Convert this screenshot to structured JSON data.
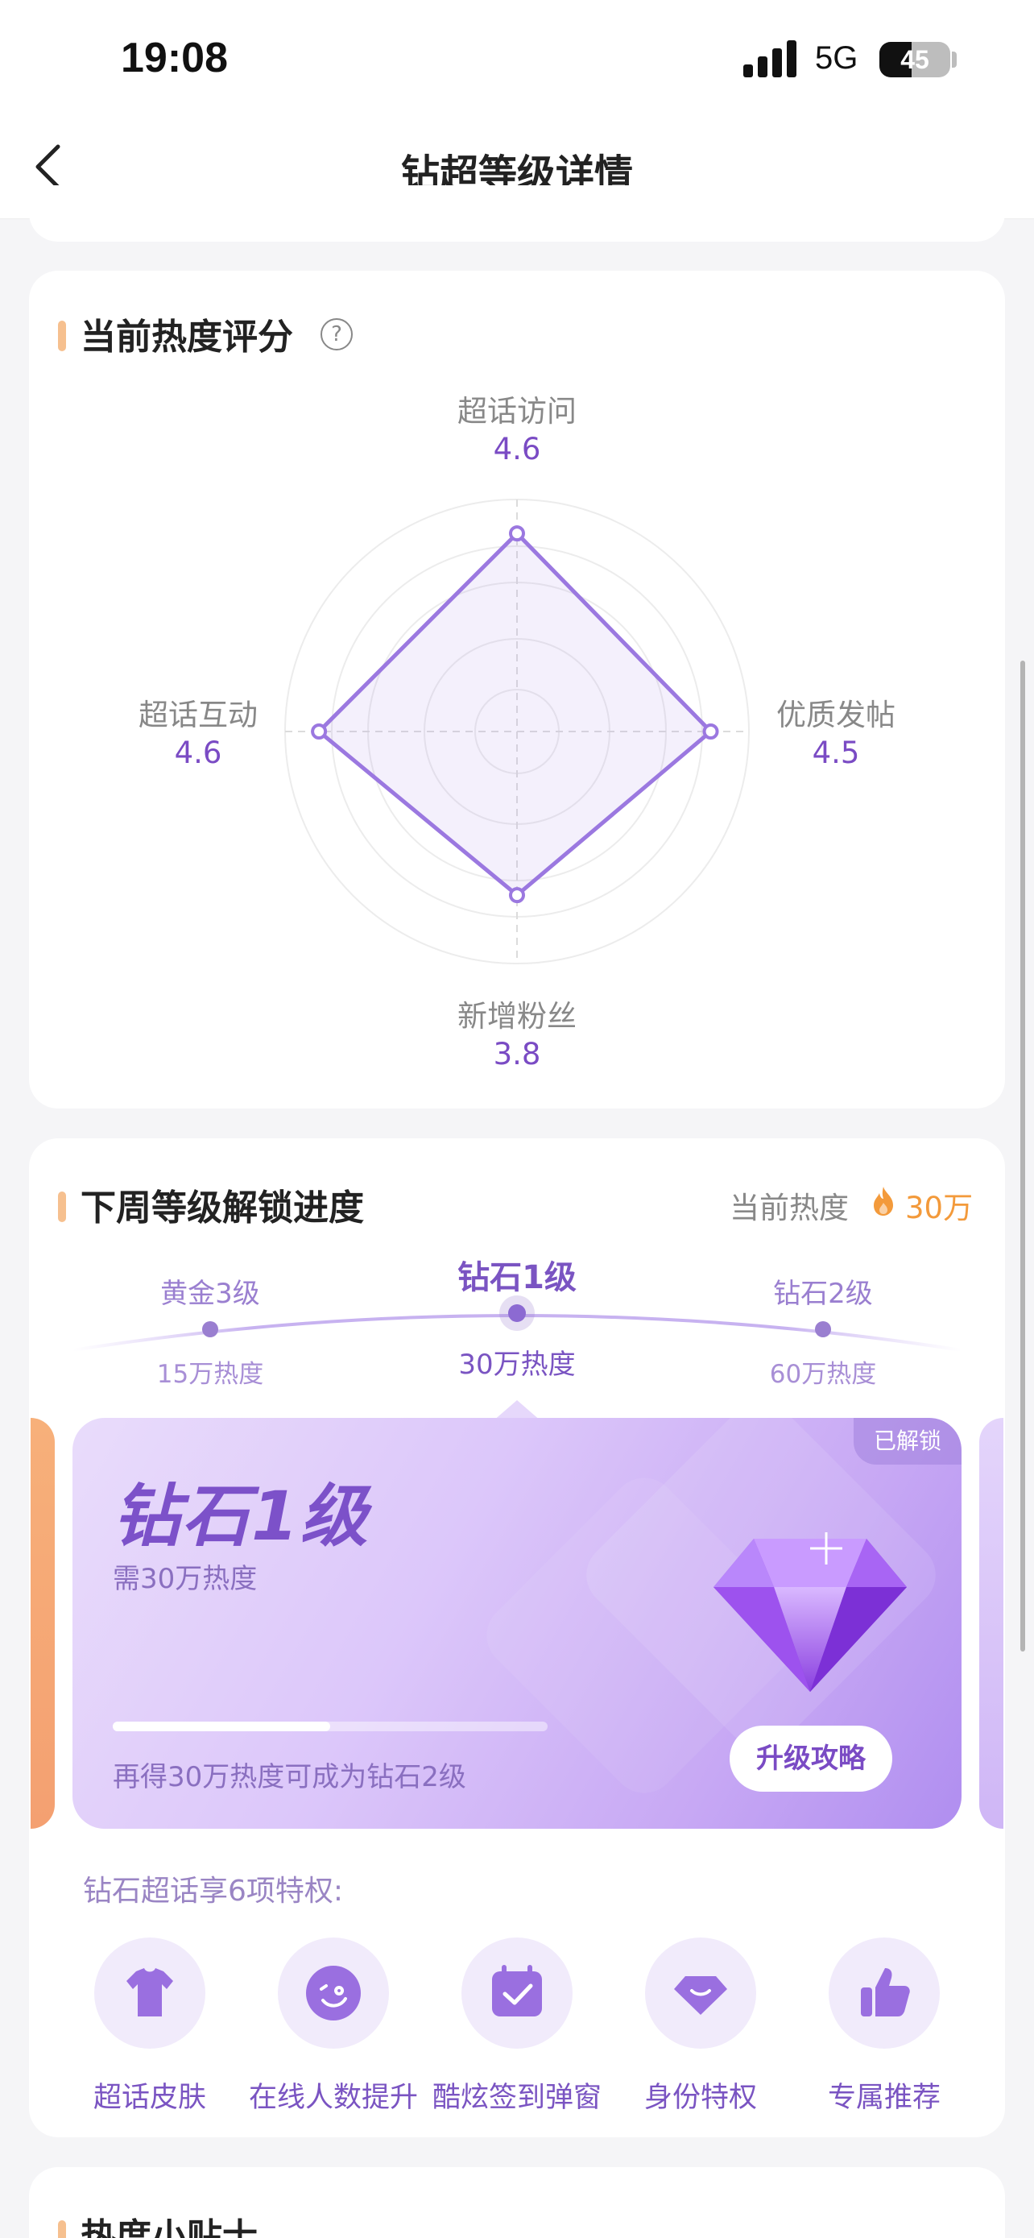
{
  "status_bar": {
    "time": "19:08",
    "network": "5G",
    "battery": "45",
    "battery_level": 0.45
  },
  "nav": {
    "title": "钻超等级详情"
  },
  "heat_score": {
    "title": "当前热度评分",
    "axes": [
      {
        "label": "超话访问",
        "value": "4.6"
      },
      {
        "label": "优质发帖",
        "value": "4.5"
      },
      {
        "label": "新增粉丝",
        "value": "3.8"
      },
      {
        "label": "超话互动",
        "value": "4.6"
      }
    ],
    "scale_max": 5
  },
  "unlock": {
    "title": "下周等级解锁进度",
    "current_heat_label": "当前热度",
    "current_heat_value": "30万",
    "levels": [
      {
        "name": "黄金3级",
        "need": "15万热度"
      },
      {
        "name": "钻石1级",
        "need": "30万热度"
      },
      {
        "name": "钻石2级",
        "need": "60万热度"
      }
    ],
    "card": {
      "badge": "已解锁",
      "title": "钻石1级",
      "need": "需30万热度",
      "progress_text": "再得30万热度可成为钻石2级",
      "progress": 0.5,
      "button": "升级攻略"
    },
    "privileges_title": "钻石超话享6项特权:",
    "privileges": [
      {
        "label": "超话皮肤",
        "icon": "tshirt-icon"
      },
      {
        "label": "在线人数提升",
        "icon": "smile-icon"
      },
      {
        "label": "酷炫签到弹窗",
        "icon": "calendar-check-icon"
      },
      {
        "label": "身份特权",
        "icon": "gem-icon"
      },
      {
        "label": "专属推荐",
        "icon": "thumbs-up-icon"
      }
    ]
  },
  "tips": {
    "title": "热度小贴士"
  },
  "colors": {
    "accent": "#7a4bc4",
    "orange": "#f39a3b",
    "title_bar": "#f6c08f"
  }
}
